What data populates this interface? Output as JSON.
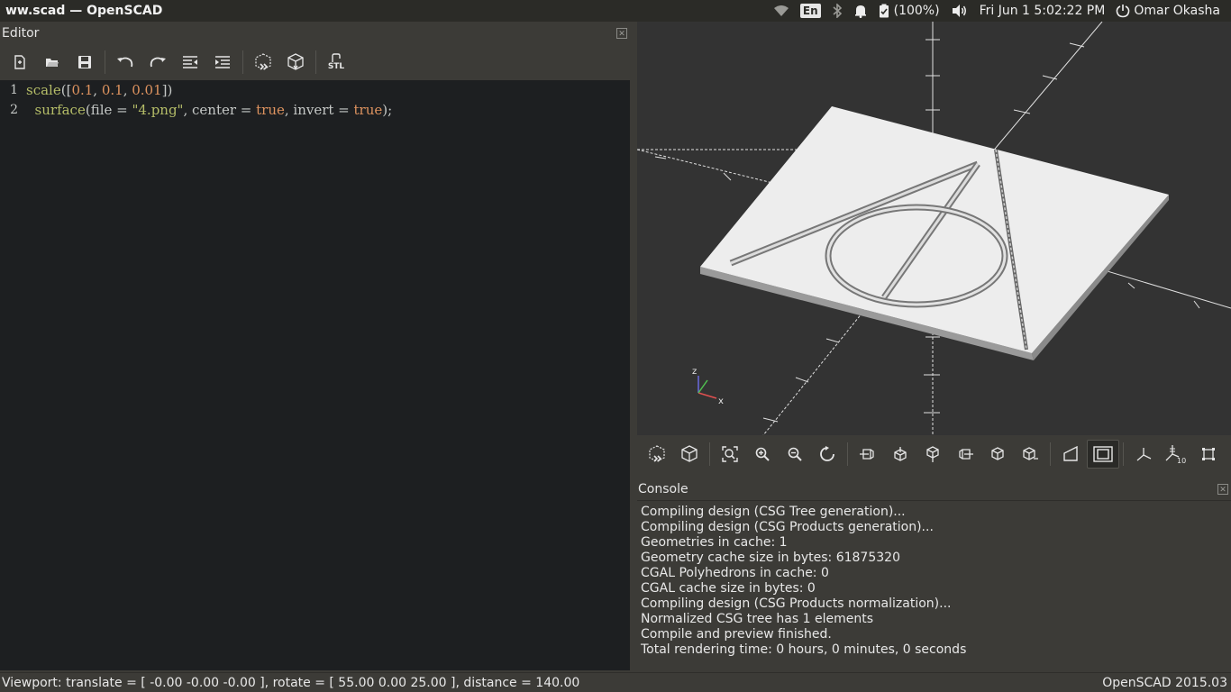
{
  "window": {
    "title": "ww.scad — OpenSCAD"
  },
  "system_tray": {
    "keyboard_layout": "En",
    "battery": "(100%)",
    "clock": "Fri Jun  1  5:02:22 PM",
    "user": "Omar Okasha"
  },
  "editor": {
    "title": "Editor",
    "toolbar": [
      "new-file",
      "open-file",
      "save-file",
      "undo",
      "redo",
      "unindent",
      "indent",
      "preview",
      "render",
      "export-stl"
    ],
    "stl_label": "STL",
    "lines": [
      {
        "number": "1",
        "tokens": [
          {
            "t": "scale",
            "c": "fn"
          },
          {
            "t": "([",
            "c": "plain"
          },
          {
            "t": "0.1",
            "c": "num"
          },
          {
            "t": ", ",
            "c": "plain"
          },
          {
            "t": "0.1",
            "c": "num"
          },
          {
            "t": ", ",
            "c": "plain"
          },
          {
            "t": "0.01",
            "c": "num"
          },
          {
            "t": "])",
            "c": "plain"
          }
        ]
      },
      {
        "number": "2",
        "tokens": [
          {
            "t": "  surface",
            "c": "fn"
          },
          {
            "t": "(file = ",
            "c": "plain"
          },
          {
            "t": "\"4.png\"",
            "c": "str"
          },
          {
            "t": ", center = ",
            "c": "plain"
          },
          {
            "t": "true",
            "c": "kw"
          },
          {
            "t": ", invert = ",
            "c": "plain"
          },
          {
            "t": "true",
            "c": "kw"
          },
          {
            "t": ");",
            "c": "plain"
          }
        ]
      }
    ]
  },
  "viewport": {
    "axis_labels": {
      "x": "x",
      "z": "z"
    }
  },
  "view_toolbar": [
    "preview",
    "render",
    "view-all",
    "zoom-in",
    "zoom-out",
    "reset-view",
    "view-right",
    "view-top",
    "view-bottom",
    "view-left",
    "view-front",
    "view-back",
    "perspective",
    "orthogonal",
    "show-axes",
    "show-scale-markers",
    "show-edges"
  ],
  "view_toolbar_scale_label": "10",
  "console": {
    "title": "Console",
    "lines": [
      "Compiling design (CSG Tree generation)...",
      "Compiling design (CSG Products generation)...",
      "Geometries in cache: 1",
      "Geometry cache size in bytes: 61875320",
      "CGAL Polyhedrons in cache: 0",
      "CGAL cache size in bytes: 0",
      "Compiling design (CSG Products normalization)...",
      "Normalized CSG tree has 1 elements",
      "Compile and preview finished.",
      "Total rendering time: 0 hours, 0 minutes, 0 seconds"
    ]
  },
  "statusbar": {
    "viewport_info": "Viewport: translate = [ -0.00 -0.00 -0.00 ], rotate = [ 55.00 0.00 25.00 ], distance = 140.00",
    "version": "OpenSCAD 2015.03"
  }
}
